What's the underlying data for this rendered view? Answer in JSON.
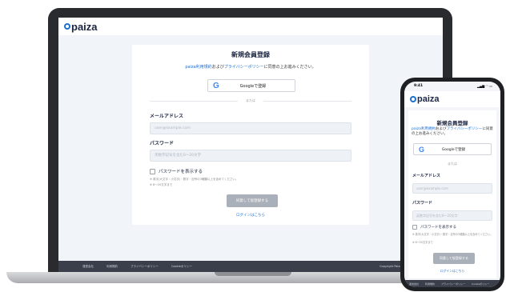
{
  "brand": {
    "name": "paiza",
    "accent_color": "#1d6fd1",
    "dark_color": "#1b2540"
  },
  "form": {
    "title": "新規会員登録",
    "consent_link1": "paiza利用規約",
    "consent_middle": "および",
    "consent_link2": "プライバシーポリシー",
    "consent_tail": "に同意の上お進みください。",
    "google_button": "Googleで登録",
    "or_text": "または",
    "email_label": "メールアドレス",
    "email_placeholder": "user@example.com",
    "password_label": "パスワード",
    "password_placeholder": "英数字記号を含む8〜20文字",
    "show_password_label": "パスワードを表示する",
    "password_note1": "※ 英字(大文字・小文字)・数字・記号の3種類以上を含めてください。",
    "password_note2": "※ 8〜20文字まで",
    "submit_button": "同意して仮登録する",
    "login_link": "ログインはこちら"
  },
  "footer": {
    "links": [
      "運営会社",
      "利用規約",
      "プライバシーポリシー",
      "Cookieポリシー"
    ],
    "copyright": "Copyright Paiza Inc. All rights reserved."
  },
  "phone": {
    "time": "9:41",
    "status_icons": "▂▄▆ ◠ ▭"
  }
}
